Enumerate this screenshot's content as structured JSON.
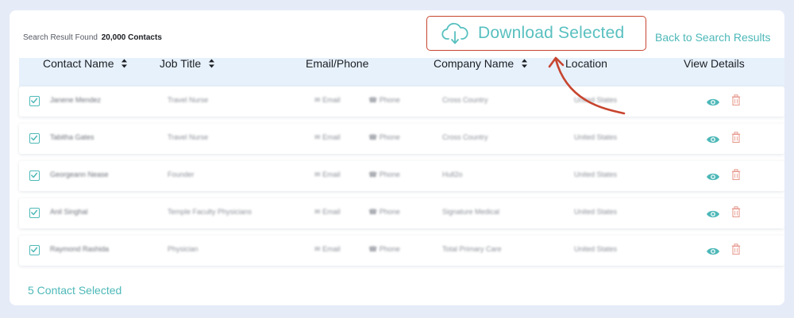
{
  "summary": {
    "prefix": "Search Result Found",
    "count": "20,000 Contacts"
  },
  "actions": {
    "download_label": "Download Selected",
    "back_label": "Back to Search Results"
  },
  "columns": [
    {
      "label": "Contact Name",
      "sortable": true
    },
    {
      "label": "Job Title",
      "sortable": true
    },
    {
      "label": "Email/Phone",
      "sortable": false
    },
    {
      "label": "Company Name",
      "sortable": true
    },
    {
      "label": "Location",
      "sortable": false
    },
    {
      "label": "View Details",
      "sortable": false
    }
  ],
  "rows": [
    {
      "checked": true,
      "name": "Janene Mendez",
      "title": "Travel Nurse",
      "email": "Email",
      "phone": "Phone",
      "company": "Cross Country",
      "location": "United States"
    },
    {
      "checked": true,
      "name": "Tabitha Gates",
      "title": "Travel Nurse",
      "email": "Email",
      "phone": "Phone",
      "company": "Cross Country",
      "location": "United States"
    },
    {
      "checked": true,
      "name": "Georgeann Nease",
      "title": "Founder",
      "email": "Email",
      "phone": "Phone",
      "company": "Hull2o",
      "location": "United States"
    },
    {
      "checked": true,
      "name": "Anil Singhal",
      "title": "Temple Faculty Physicians",
      "email": "Email",
      "phone": "Phone",
      "company": "Signature Medical",
      "location": "United States"
    },
    {
      "checked": true,
      "name": "Raymond Rashida",
      "title": "Physician",
      "email": "Email",
      "phone": "Phone",
      "company": "Total Primary Care",
      "location": "United States"
    }
  ],
  "footer": {
    "selected_label": "5 Contact Selected"
  },
  "colors": {
    "accent": "#4eb8b8",
    "annotation": "#c7452f",
    "header_bg": "#e7f1fb",
    "page_bg": "#e6ebf8",
    "trash": "#e79a8e"
  },
  "icons": {
    "download": "cloud-download-icon",
    "view": "eye-icon",
    "delete": "trash-icon",
    "sort": "sort-icon",
    "check": "checkbox-icon",
    "mail": "mail-icon",
    "phone": "phone-icon"
  }
}
